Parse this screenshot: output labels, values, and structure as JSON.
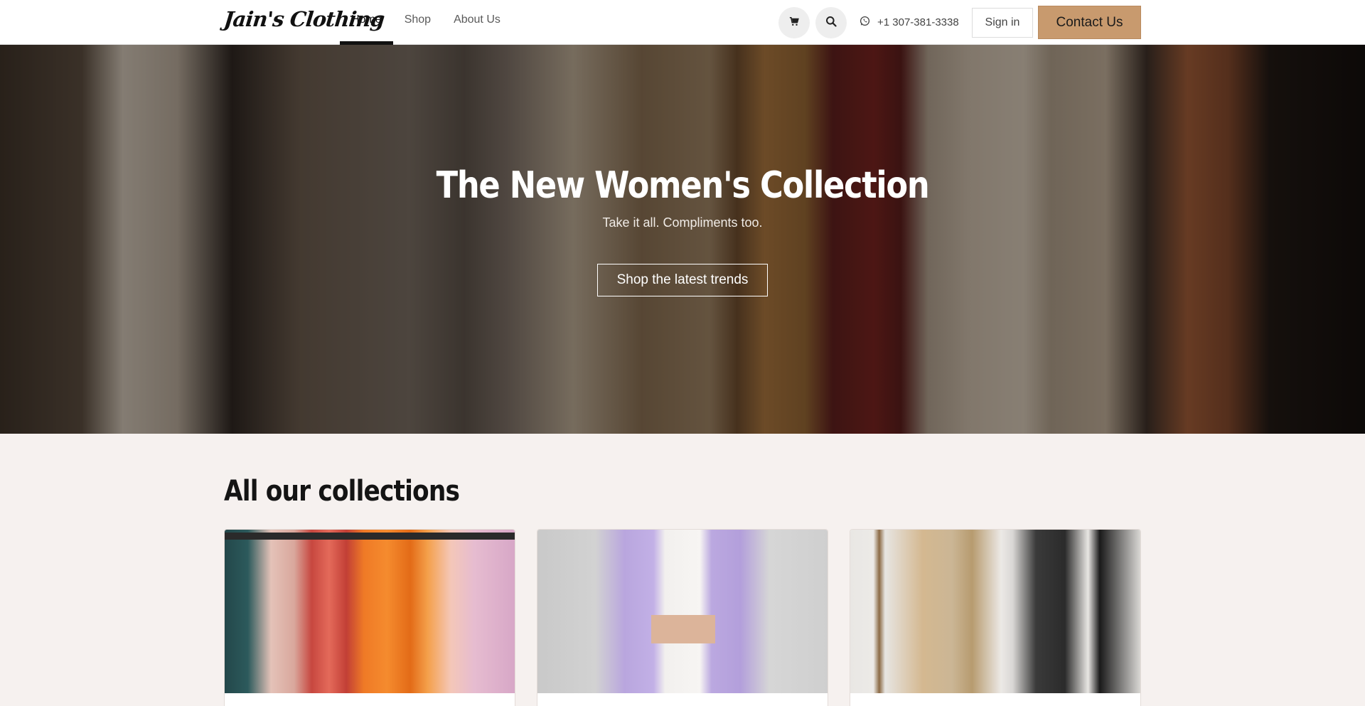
{
  "header": {
    "logo_text": "Jain's Clothing",
    "nav": [
      {
        "label": "Home",
        "active": true
      },
      {
        "label": "Shop",
        "active": false
      },
      {
        "label": "About Us",
        "active": false
      }
    ],
    "cart_icon": "cart-icon",
    "search_icon": "search-icon",
    "phone_icon": "whatsapp-icon",
    "phone": "+1 307-381-3338",
    "signin_label": "Sign in",
    "contact_label": "Contact Us",
    "contact_color": "#c89a6e"
  },
  "hero": {
    "title": "The New Women's Collection",
    "subtitle": "Take it all. Compliments too.",
    "cta_label": "Shop the latest trends"
  },
  "collections": {
    "title": "All our collections"
  }
}
